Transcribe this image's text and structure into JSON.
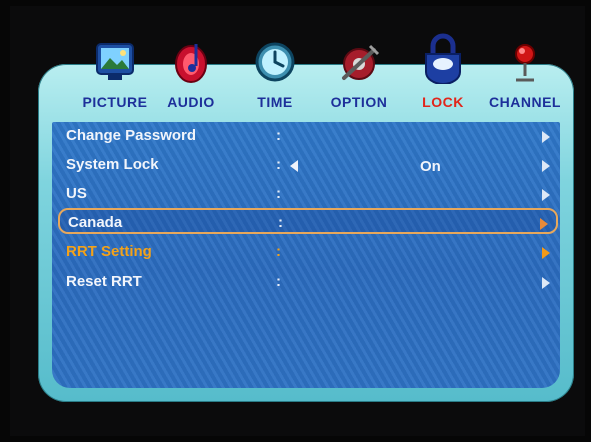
{
  "tabs": [
    {
      "label": "PICTURE",
      "icon": "picture-icon",
      "active": false
    },
    {
      "label": "AUDIO",
      "icon": "audio-icon",
      "active": false
    },
    {
      "label": "TIME",
      "icon": "clock-icon",
      "active": false
    },
    {
      "label": "OPTION",
      "icon": "option-icon",
      "active": false
    },
    {
      "label": "LOCK",
      "icon": "lock-icon",
      "active": true
    },
    {
      "label": "CHANNEL",
      "icon": "channel-icon",
      "active": false
    }
  ],
  "menu": {
    "items": [
      {
        "label": "Change Password",
        "colon": ":",
        "value": ""
      },
      {
        "label": "System Lock",
        "colon": ":",
        "value": "On"
      },
      {
        "label": "US",
        "colon": ":",
        "value": ""
      },
      {
        "label": "Canada",
        "colon": ":",
        "value": "",
        "state": "selected"
      },
      {
        "label": "RRT Setting",
        "colon": ":",
        "value": "",
        "state": "highlighted"
      },
      {
        "label": "Reset RRT",
        "colon": ":",
        "value": ""
      }
    ]
  },
  "colors": {
    "active_tab": "#e1251b",
    "tab_text": "#1d2f9a",
    "highlight": "#f3a21a",
    "panel": "#2f78c9"
  }
}
